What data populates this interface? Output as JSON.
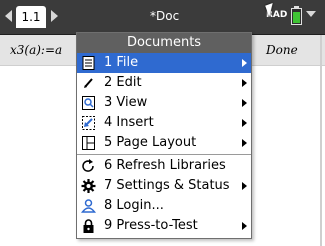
{
  "tabbar": {
    "active_tab": "1.1",
    "doc_title": "*Doc",
    "angle_mode": "RAD"
  },
  "calculator": {
    "expression": "x3(a):=a",
    "result": "Done"
  },
  "menu": {
    "title": "Documents",
    "items": [
      {
        "number": "1",
        "label": "File",
        "icon": "file-icon",
        "has_submenu": true,
        "selected": true
      },
      {
        "number": "2",
        "label": "Edit",
        "icon": "pencil-icon",
        "has_submenu": true,
        "selected": false
      },
      {
        "number": "3",
        "label": "View",
        "icon": "view-icon",
        "has_submenu": true,
        "selected": false
      },
      {
        "number": "4",
        "label": "Insert",
        "icon": "insert-icon",
        "has_submenu": true,
        "selected": false
      },
      {
        "number": "5",
        "label": "Page Layout",
        "icon": "page-layout-icon",
        "has_submenu": true,
        "selected": false
      },
      {
        "number": "6",
        "label": "Refresh Libraries",
        "icon": "refresh-icon",
        "has_submenu": false,
        "selected": false
      },
      {
        "number": "7",
        "label": "Settings & Status",
        "icon": "gear-icon",
        "has_submenu": true,
        "selected": false
      },
      {
        "number": "8",
        "label": "Login...",
        "icon": "user-icon",
        "has_submenu": false,
        "selected": false
      },
      {
        "number": "9",
        "label": "Press-to-Test",
        "icon": "lock-icon",
        "has_submenu": true,
        "selected": false
      }
    ],
    "labels": [
      "1  File",
      "2  Edit",
      "3  View",
      "4  Insert",
      "5  Page Layout",
      "6  Refresh Libraries",
      "7  Settings & Status",
      "8  Login...",
      "9  Press-to-Test"
    ]
  },
  "colors": {
    "tabbar_bg": "#3b3b3b",
    "menu_header_bg": "#606060",
    "selection_bg": "#2f6ad0",
    "battery_green": "#3fc434"
  }
}
